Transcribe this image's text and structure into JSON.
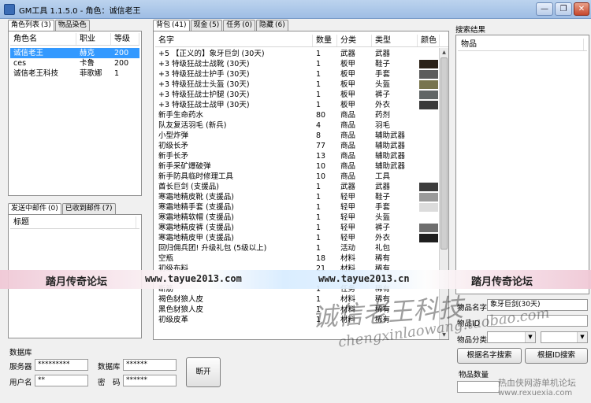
{
  "window": {
    "title": "GM工具 1.1.5.0  -  角色：诚信老王",
    "minimize_glyph": "—",
    "restore_glyph": "❐",
    "close_glyph": "✕"
  },
  "left_tabs": [
    {
      "label": "角色列表",
      "count": "(3)"
    },
    {
      "label": "物品染色",
      "count": ""
    }
  ],
  "characters": {
    "headers": [
      "角色名",
      "职业",
      "等级"
    ],
    "rows": [
      {
        "name": "诚信老王",
        "job": "赫克",
        "level": "200",
        "selected": true
      },
      {
        "name": "ces",
        "job": "卡鲁",
        "level": "200",
        "selected": false
      },
      {
        "name": "诚信老王科技",
        "job": "菲歌娜",
        "level": "1",
        "selected": false
      }
    ]
  },
  "mail_tabs": [
    {
      "label": "发送中邮件",
      "count": "(0)"
    },
    {
      "label": "已收到邮件",
      "count": "(7)"
    }
  ],
  "mail": {
    "header": "标题"
  },
  "db": {
    "group_label": "数据库",
    "server_label": "服务器",
    "server_value": "*********",
    "dbname_label": "数据库",
    "dbname_value": "******",
    "user_label": "用户名",
    "user_value": "**",
    "pass_label": "密　码",
    "pass_value": "******",
    "disconnect_label": "断开"
  },
  "inv_tabs": [
    {
      "label": "背包",
      "count": "(41)"
    },
    {
      "label": "现金",
      "count": "(5)"
    },
    {
      "label": "任务",
      "count": "(0)"
    },
    {
      "label": "隐藏",
      "count": "(6)"
    }
  ],
  "inventory": {
    "headers": [
      "名字",
      "数量",
      "分类",
      "类型",
      "颜色"
    ],
    "rows": [
      {
        "name": "+5 【正义的】象牙巨剑 (30天)",
        "qty": "1",
        "cat": "武器",
        "type": "武器",
        "color": ""
      },
      {
        "name": "+3 特级狂战士战靴 (30天)",
        "qty": "1",
        "cat": "板甲",
        "type": "鞋子",
        "color": "#2b2218"
      },
      {
        "name": "+3 特级狂战士护手 (30天)",
        "qty": "1",
        "cat": "板甲",
        "type": "手套",
        "color": "#5c5c5c"
      },
      {
        "name": "+3 特级狂战士头盔 (30天)",
        "qty": "1",
        "cat": "板甲",
        "type": "头盔",
        "color": "#77744e"
      },
      {
        "name": "+3 特级狂战士护腿 (30天)",
        "qty": "1",
        "cat": "板甲",
        "type": "裤子",
        "color": "#616666"
      },
      {
        "name": "+3 特级狂战士战甲 (30天)",
        "qty": "1",
        "cat": "板甲",
        "type": "外衣",
        "color": "#3a3a3a"
      },
      {
        "name": "新手生命药水",
        "qty": "80",
        "cat": "商品",
        "type": "药剂",
        "color": ""
      },
      {
        "name": "队友复活羽毛 (新兵)",
        "qty": "4",
        "cat": "商品",
        "type": "羽毛",
        "color": ""
      },
      {
        "name": "小型炸弹",
        "qty": "8",
        "cat": "商品",
        "type": "辅助武器",
        "color": ""
      },
      {
        "name": "初级长矛",
        "qty": "77",
        "cat": "商品",
        "type": "辅助武器",
        "color": ""
      },
      {
        "name": "新手长矛",
        "qty": "13",
        "cat": "商品",
        "type": "辅助武器",
        "color": ""
      },
      {
        "name": "新手采矿爆破弹",
        "qty": "10",
        "cat": "商品",
        "type": "辅助武器",
        "color": ""
      },
      {
        "name": "新手防具临时修理工具",
        "qty": "10",
        "cat": "商品",
        "type": "工具",
        "color": ""
      },
      {
        "name": "酋长巨剑 (支援品)",
        "qty": "1",
        "cat": "武器",
        "type": "武器",
        "color": "#3c3c3c"
      },
      {
        "name": "寒霜地精皮靴 (支援品)",
        "qty": "1",
        "cat": "轻甲",
        "type": "鞋子",
        "color": "#9a9a9a"
      },
      {
        "name": "寒霜地精手套 (支援品)",
        "qty": "1",
        "cat": "轻甲",
        "type": "手套",
        "color": "#dcdcdc"
      },
      {
        "name": "寒霜地精软帽 (支援品)",
        "qty": "1",
        "cat": "轻甲",
        "type": "头盔",
        "color": ""
      },
      {
        "name": "寒霜地精皮裤 (支援品)",
        "qty": "1",
        "cat": "轻甲",
        "type": "裤子",
        "color": "#6e6e6e"
      },
      {
        "name": "寒霜地精皮甲 (支援品)",
        "qty": "1",
        "cat": "轻甲",
        "type": "外衣",
        "color": "#1e1e1e"
      },
      {
        "name": "回归佣兵团! 升级礼包 (5级以上)",
        "qty": "1",
        "cat": "活动",
        "type": "礼包",
        "color": ""
      },
      {
        "name": "空瓶",
        "qty": "18",
        "cat": "材料",
        "type": "稀有",
        "color": ""
      },
      {
        "name": "初级布料",
        "qty": "21",
        "cat": "材料",
        "type": "稀有",
        "color": ""
      },
      {
        "name": "",
        "qty": "",
        "cat": "",
        "type": "",
        "color": ""
      },
      {
        "name": "断筋",
        "qty": "1",
        "cat": "任务",
        "type": "稀有",
        "color": ""
      },
      {
        "name": "褐色豺狼人皮",
        "qty": "1",
        "cat": "材料",
        "type": "稀有",
        "color": ""
      },
      {
        "name": "黑色豺狼人皮",
        "qty": "1",
        "cat": "材料",
        "type": "稀有",
        "color": ""
      },
      {
        "name": "初级皮革",
        "qty": "1",
        "cat": "材料",
        "type": "稀有",
        "color": ""
      }
    ]
  },
  "search": {
    "group_label": "搜索结果",
    "header": "物品",
    "item_name_label": "物品名字",
    "item_name_value": "象牙巨剑(30天)",
    "item_id_label": "物品ID",
    "category_label": "物品分类",
    "category_value": "",
    "type_value": "",
    "by_name_button": "根据名字搜索",
    "by_id_button": "根据ID搜索",
    "qty_label": "物品数量"
  },
  "banner": {
    "left_text": "踏月传奇论坛",
    "url_1": "www.tayue2013.com",
    "url_2": "www.tayue2013.cn",
    "right_text": "踏月传奇论坛"
  },
  "watermarks": {
    "brand": "诚信老王科技",
    "shop": "chengxinlaowang.taobao.com",
    "forum": "热血侠网游单机论坛",
    "forum_url": "www.rexuexia.com"
  }
}
